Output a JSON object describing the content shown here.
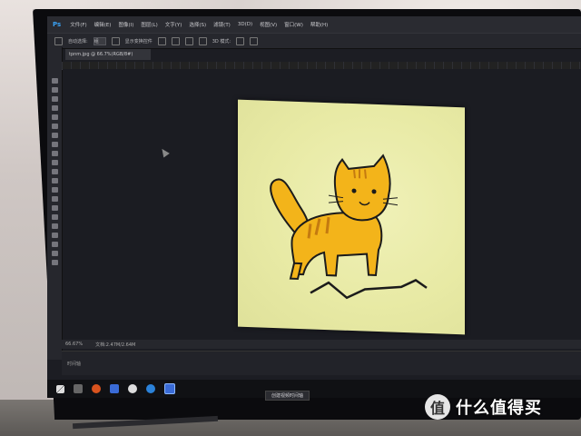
{
  "app": {
    "logo": "Ps",
    "menu": [
      "文件(F)",
      "编辑(E)",
      "图像(I)",
      "图层(L)",
      "文字(Y)",
      "选择(S)",
      "滤镜(T)",
      "3D(D)",
      "视图(V)",
      "窗口(W)",
      "帮助(H)"
    ]
  },
  "options": {
    "auto_select_label": "自动选择:",
    "auto_select_value": "组",
    "show_transform_label": "显示变换控件",
    "mode_label": "3D 模式:"
  },
  "document": {
    "tab_title": "tpnm.jpg @ 66.7%(RGB/8#)"
  },
  "status": {
    "zoom": "66.67%",
    "doc_size": "文档:2.47M/2.64M",
    "timeline_label": "时间轴"
  },
  "taskbar": {
    "label": "创建视频时间轴"
  },
  "watermark": {
    "text": "什么值得买",
    "icon": "值"
  },
  "colors": {
    "accent": "#3aa0f0",
    "cat_fill": "#f3b41a",
    "cat_outline": "#1b1b1b",
    "canvas_bg": "#e8eaa5"
  }
}
